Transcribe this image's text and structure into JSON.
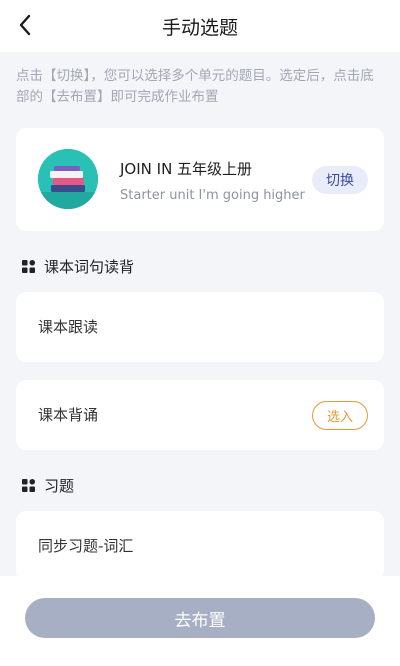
{
  "header": {
    "title": "手动选题",
    "back_icon": "chevron-left-icon"
  },
  "hint": "点击【切换】，您可以选择多个单元的题目。选定后，点击底部的【去布置】即可完成作业布置",
  "book": {
    "title": "JOIN IN 五年级上册",
    "subtitle": "Starter unit I'm going higher",
    "switch_label": "切换"
  },
  "sections": [
    {
      "title": "课本词句读背",
      "icon": "grid-icon",
      "items": [
        {
          "label": "课本跟读"
        },
        {
          "label": "课本背诵",
          "action": "选入"
        }
      ]
    },
    {
      "title": "习题",
      "icon": "grid-icon",
      "items": [
        {
          "label": "同步习题-词汇"
        }
      ]
    }
  ],
  "footer": {
    "assign_label": "去布置"
  },
  "colors": {
    "accent_orange": "#e39a3b",
    "switch_text": "#3b4aa3",
    "switch_bg": "#e9edfb",
    "button_disabled": "#a7afc4",
    "page_bg": "#f4f5f9",
    "avatar_bg": "#29c0b6"
  }
}
